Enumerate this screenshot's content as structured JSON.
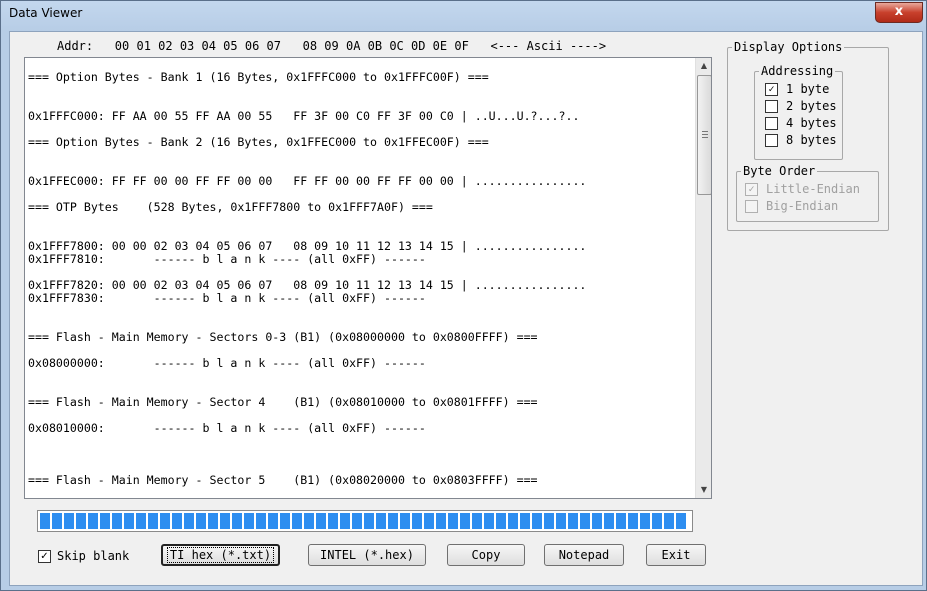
{
  "window": {
    "title": "Data Viewer",
    "close_glyph": "x"
  },
  "viewer": {
    "header": "Addr:   00 01 02 03 04 05 06 07   08 09 0A 0B 0C 0D 0E 0F   <--- Ascii ---->",
    "lines": [
      "=== Option Bytes - Bank 1 (16 Bytes, 0x1FFFC000 to 0x1FFFC00F) ===",
      "",
      "",
      "0x1FFFC000: FF AA 00 55 FF AA 00 55   FF 3F 00 C0 FF 3F 00 C0 | ..U...U.?...?..",
      "",
      "=== Option Bytes - Bank 2 (16 Bytes, 0x1FFEC000 to 0x1FFEC00F) ===",
      "",
      "",
      "0x1FFEC000: FF FF 00 00 FF FF 00 00   FF FF 00 00 FF FF 00 00 | ................",
      "",
      "=== OTP Bytes    (528 Bytes, 0x1FFF7800 to 0x1FFF7A0F) ===",
      "",
      "",
      "0x1FFF7800: 00 00 02 03 04 05 06 07   08 09 10 11 12 13 14 15 | ................",
      "0x1FFF7810:       ------ b l a n k ---- (all 0xFF) ------",
      "",
      "0x1FFF7820: 00 00 02 03 04 05 06 07   08 09 10 11 12 13 14 15 | ................",
      "0x1FFF7830:       ------ b l a n k ---- (all 0xFF) ------",
      "",
      "",
      "=== Flash - Main Memory - Sectors 0-3 (B1) (0x08000000 to 0x0800FFFF) ===",
      "",
      "0x08000000:       ------ b l a n k ---- (all 0xFF) ------",
      "",
      "",
      "=== Flash - Main Memory - Sector 4    (B1) (0x08010000 to 0x0801FFFF) ===",
      "",
      "0x08010000:       ------ b l a n k ---- (all 0xFF) ------",
      "",
      "",
      "",
      "=== Flash - Main Memory - Sector 5    (B1) (0x08020000 to 0x0803FFFF) ==="
    ]
  },
  "progress": {
    "fraction": 1.0,
    "segments": 54
  },
  "skip_blank": {
    "label": "Skip blank",
    "checked": true,
    "mark": "✓"
  },
  "buttons": {
    "ti_hex": "TI hex (*.txt)",
    "intel": "INTEL (*.hex)",
    "copy": "Copy",
    "notepad": "Notepad",
    "exit": "Exit"
  },
  "display_options": {
    "title": "Display Options",
    "addressing": {
      "title": "Addressing",
      "options": [
        {
          "label": "1 byte",
          "checked": true
        },
        {
          "label": "2 bytes",
          "checked": false
        },
        {
          "label": "4 bytes",
          "checked": false
        },
        {
          "label": "8 bytes",
          "checked": false
        }
      ]
    },
    "byte_order": {
      "title": "Byte Order",
      "options": [
        {
          "label": "Little-Endian",
          "checked": true
        },
        {
          "label": "Big-Endian",
          "checked": false
        }
      ]
    }
  },
  "icons": {
    "close": "close-icon",
    "scroll_up": "arrow-up-icon",
    "scroll_down": "arrow-down-icon",
    "scroll_grip": "grip-icon"
  },
  "colors": {
    "progress_fill": "#2e8ef0",
    "titlebar": "#b9d1ea",
    "close_button": "#c8402c"
  }
}
